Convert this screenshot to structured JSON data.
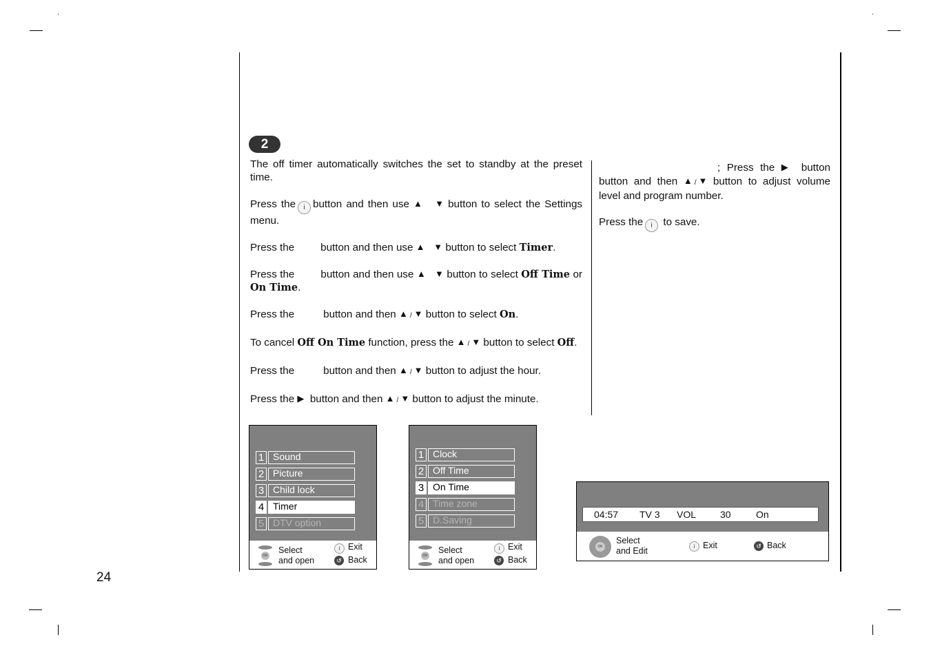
{
  "page": {
    "number": "24",
    "step_badge": "2"
  },
  "glyphs": {
    "up": "▲",
    "down": "▼",
    "right": "▶",
    "slash": "/",
    "info_button": "i",
    "ok": "OK",
    "back": "↺"
  },
  "left_column": {
    "intro_line": "The off timer automatically switches the set to standby at the preset time.",
    "step1": {
      "a": "Press the",
      "b": "button and then use",
      "c": "button to select the Settings menu."
    },
    "step2": {
      "a": "Press the",
      "b": "button and then use",
      "c": "button to select",
      "kw": "Timer",
      "end": "."
    },
    "step3": {
      "a": "Press the",
      "b": "button and then use",
      "c": "button to select",
      "kw1": "Off Time",
      "or": "or",
      "kw2": "On Time",
      "end": "."
    },
    "step4": {
      "a": "Press the",
      "b": "button and then",
      "c": "button to select",
      "kw": "On",
      "end": "."
    },
    "cancel_note": {
      "a": "To cancel",
      "kw": "Off On Time",
      "b": "function, press the",
      "c": "button to select",
      "kw2": "Off",
      "end": "."
    },
    "step5": {
      "a": "Press the",
      "b": "button and then",
      "c": "button to adjust the hour."
    },
    "step6": {
      "a": "Press the",
      "b": "button and then",
      "c": "button to adjust the minute."
    }
  },
  "right_column": {
    "step7": {
      "a": "; Press the",
      "b": "button and then",
      "c": "button to adjust volume level and program number."
    },
    "step8": {
      "a": "Press the",
      "b": "to save."
    }
  },
  "settings_menu": {
    "items": [
      {
        "num": "1",
        "label": "Sound",
        "state": "normal"
      },
      {
        "num": "2",
        "label": "Picture",
        "state": "normal"
      },
      {
        "num": "3",
        "label": "Child lock",
        "state": "normal"
      },
      {
        "num": "4",
        "label": "Timer",
        "state": "selected"
      },
      {
        "num": "5",
        "label": "DTV option",
        "state": "disabled"
      }
    ],
    "footer": {
      "nav_label_1": "Select",
      "nav_label_2": "and open",
      "exit_label": "Exit",
      "back_label": "Back"
    }
  },
  "timer_menu": {
    "items": [
      {
        "num": "1",
        "label": "Clock",
        "state": "normal"
      },
      {
        "num": "2",
        "label": "Off Time",
        "state": "normal"
      },
      {
        "num": "3",
        "label": "On Time",
        "state": "selected"
      },
      {
        "num": "4",
        "label": "Time zone",
        "state": "disabled"
      },
      {
        "num": "5",
        "label": "D.Saving",
        "state": "disabled"
      }
    ],
    "footer": {
      "nav_label_1": "Select",
      "nav_label_2": "and open",
      "exit_label": "Exit",
      "back_label": "Back"
    }
  },
  "on_time_editor": {
    "time": "04:57",
    "source": "TV 3",
    "vol_label": "VOL",
    "vol_value": "30",
    "state": "On",
    "footer": {
      "nav_label_1": "Select",
      "nav_label_2": "and Edit",
      "exit_label": "Exit",
      "back_label": "Back"
    }
  },
  "colors": {
    "osd_background": "#808080",
    "badge_background": "#333333"
  }
}
